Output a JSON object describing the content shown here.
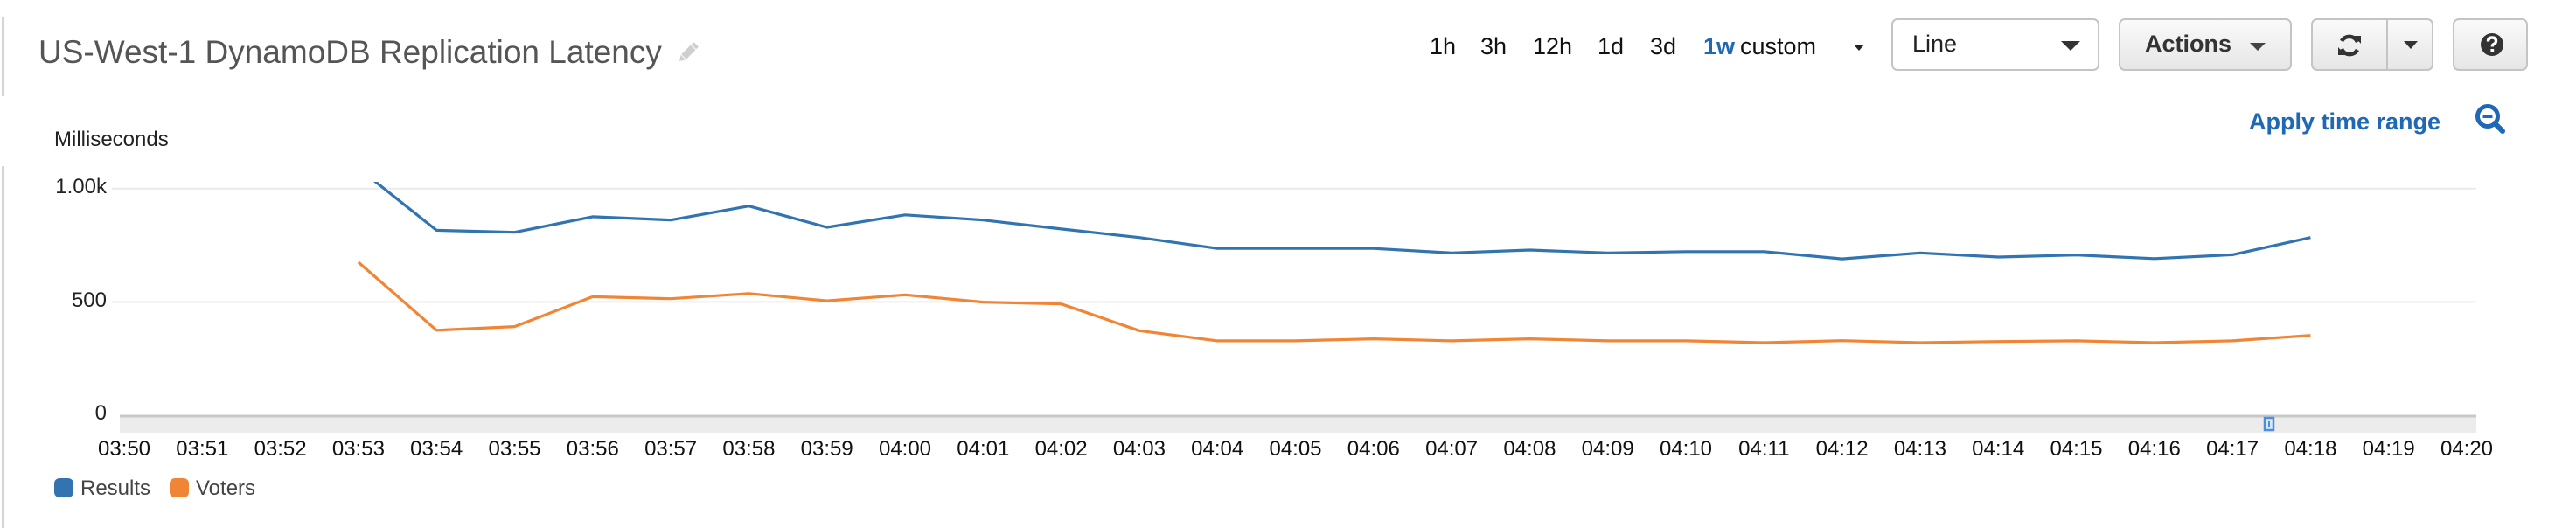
{
  "header": {
    "title": "US-West-1 DynamoDB Replication Latency",
    "edit_icon": "pencil-icon",
    "time_ranges": [
      {
        "label": "1h",
        "active": false
      },
      {
        "label": "3h",
        "active": false
      },
      {
        "label": "12h",
        "active": false
      },
      {
        "label": "1d",
        "active": false
      },
      {
        "label": "3d",
        "active": false
      },
      {
        "label": "1w",
        "active": true
      },
      {
        "label": "custom",
        "active": false
      }
    ],
    "graph_type_select": {
      "value": "Line"
    },
    "actions_label": "Actions",
    "refresh_icon": "refresh-icon",
    "help_icon": "question-circle-icon",
    "apply_time_range_label": "Apply time range",
    "zoom_out_icon": "zoom-out-icon"
  },
  "colors": {
    "accent": "#1f68b6",
    "results": "#3274b0",
    "voters": "#f08536",
    "grid": "#ececec"
  },
  "chart_data": {
    "type": "line",
    "title": "US-West-1 DynamoDB Replication Latency",
    "xlabel": "",
    "ylabel": "Milliseconds",
    "ylim": [
      0,
      1000
    ],
    "yticks": [
      {
        "value": 1000,
        "label": "1.00k"
      },
      {
        "value": 500,
        "label": "500"
      },
      {
        "value": 0,
        "label": "0"
      }
    ],
    "x": [
      "03:50",
      "03:51",
      "03:52",
      "03:53",
      "03:54",
      "03:55",
      "03:56",
      "03:57",
      "03:58",
      "03:59",
      "04:00",
      "04:01",
      "04:02",
      "04:03",
      "04:04",
      "04:05",
      "04:06",
      "04:07",
      "04:08",
      "04:09",
      "04:10",
      "04:11",
      "04:12",
      "04:13",
      "04:14",
      "04:15",
      "04:16",
      "04:17",
      "04:18",
      "04:19",
      "04:20"
    ],
    "grid": true,
    "legend": "bottom-left",
    "series": [
      {
        "name": "Results",
        "color": "#3274b0",
        "values": [
          null,
          null,
          null,
          1090,
          816,
          807,
          876,
          861,
          923,
          829,
          884,
          861,
          822,
          784,
          736,
          736,
          736,
          716,
          729,
          716,
          722,
          722,
          690,
          716,
          698,
          707,
          691,
          708,
          784,
          null,
          null
        ]
      },
      {
        "name": "Voters",
        "color": "#f08536",
        "values": [
          null,
          null,
          null,
          675,
          375,
          391,
          523,
          514,
          537,
          505,
          531,
          499,
          491,
          373,
          328,
          328,
          337,
          328,
          337,
          328,
          328,
          320,
          329,
          320,
          325,
          328,
          320,
          328,
          352,
          null,
          null
        ]
      }
    ]
  }
}
